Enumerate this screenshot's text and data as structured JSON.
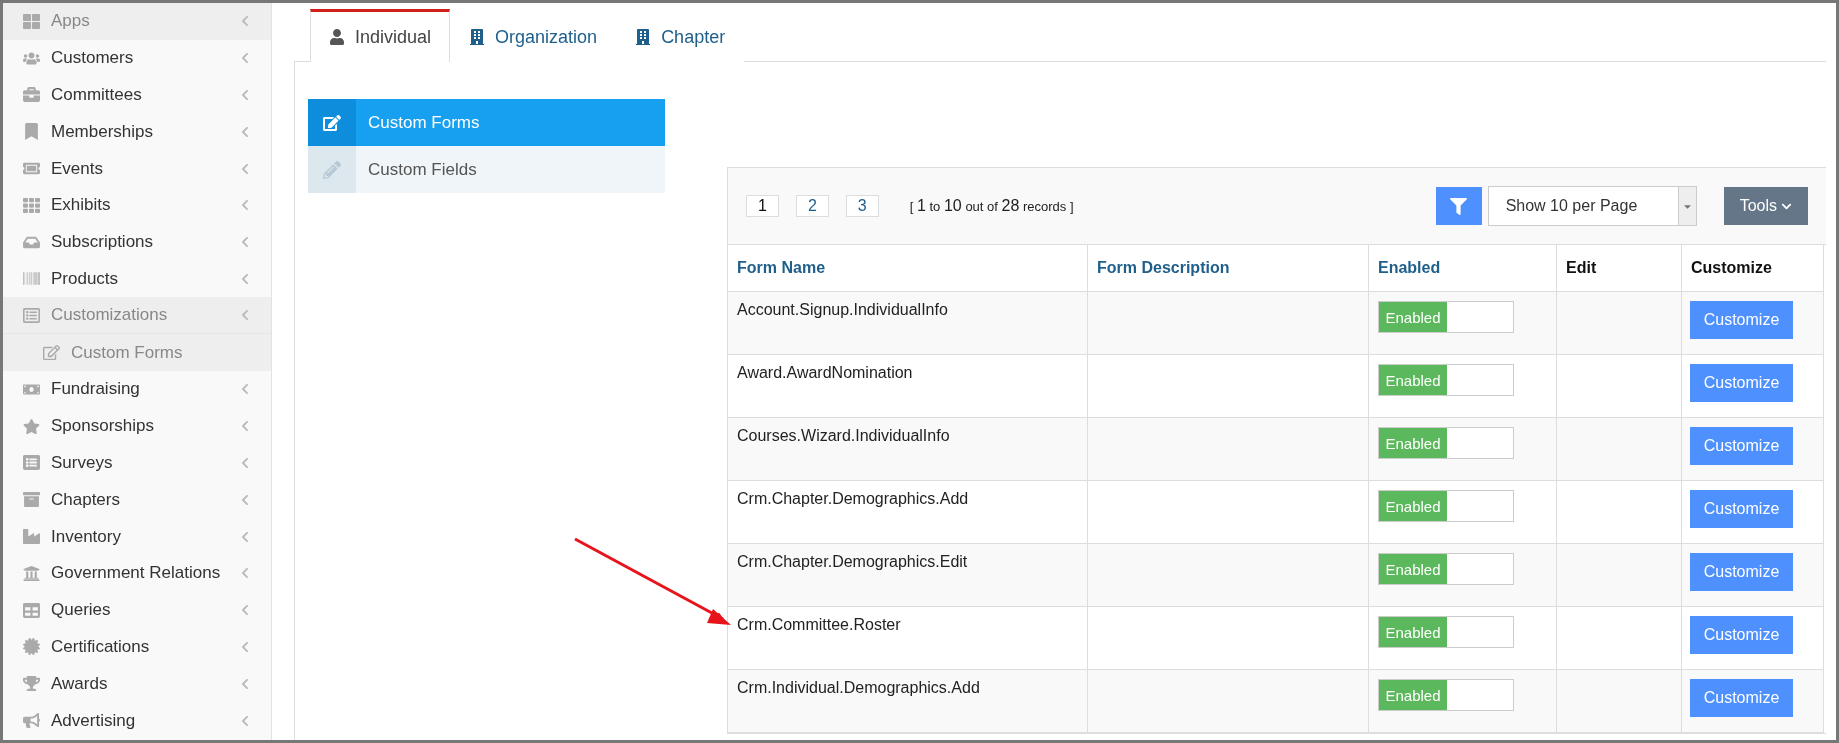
{
  "sidebar": {
    "items": [
      {
        "label": "Apps",
        "selected": true,
        "expanded": false
      },
      {
        "label": "Customers",
        "selected": false,
        "expanded": false
      },
      {
        "label": "Committees",
        "selected": false,
        "expanded": false
      },
      {
        "label": "Memberships",
        "selected": false,
        "expanded": false
      },
      {
        "label": "Events",
        "selected": false,
        "expanded": false
      },
      {
        "label": "Exhibits",
        "selected": false,
        "expanded": false
      },
      {
        "label": "Subscriptions",
        "selected": false,
        "expanded": false
      },
      {
        "label": "Products",
        "selected": false,
        "expanded": false
      },
      {
        "label": "Customizations",
        "selected": true,
        "expanded": true,
        "children": [
          {
            "label": "Custom Forms",
            "selected": true
          }
        ]
      },
      {
        "label": "Fundraising",
        "selected": false,
        "expanded": false
      },
      {
        "label": "Sponsorships",
        "selected": false,
        "expanded": false
      },
      {
        "label": "Surveys",
        "selected": false,
        "expanded": false
      },
      {
        "label": "Chapters",
        "selected": false,
        "expanded": false
      },
      {
        "label": "Inventory",
        "selected": false,
        "expanded": false
      },
      {
        "label": "Government Relations",
        "selected": false,
        "expanded": false
      },
      {
        "label": "Queries",
        "selected": false,
        "expanded": false
      },
      {
        "label": "Certifications",
        "selected": false,
        "expanded": false
      },
      {
        "label": "Awards",
        "selected": false,
        "expanded": false
      },
      {
        "label": "Advertising",
        "selected": false,
        "expanded": false
      }
    ]
  },
  "tabs": [
    {
      "label": "Individual",
      "selected": true
    },
    {
      "label": "Organization",
      "selected": false
    },
    {
      "label": "Chapter",
      "selected": false
    }
  ],
  "subnav": [
    {
      "label": "Custom Forms",
      "selected": true
    },
    {
      "label": "Custom Fields",
      "selected": false
    }
  ],
  "toolbar": {
    "pages": [
      {
        "label": "1",
        "selected": true
      },
      {
        "label": "2",
        "selected": false
      },
      {
        "label": "3",
        "selected": false
      }
    ],
    "records": [
      {
        "kind": "word",
        "text": "["
      },
      {
        "kind": "number",
        "text": "1"
      },
      {
        "kind": "word",
        "text": "to"
      },
      {
        "kind": "number",
        "text": "10"
      },
      {
        "kind": "word",
        "text": "out of"
      },
      {
        "kind": "number",
        "text": "28"
      },
      {
        "kind": "word",
        "text": "records"
      },
      {
        "kind": "word",
        "text": "]"
      }
    ],
    "per_page": "Show 10 per Page",
    "tools": "Tools"
  },
  "table": {
    "columns": [
      {
        "label": "Form Name",
        "sortable": true
      },
      {
        "label": "Form Description",
        "sortable": true
      },
      {
        "label": "Enabled",
        "sortable": true
      },
      {
        "label": "Edit",
        "sortable": false
      },
      {
        "label": "Customize",
        "sortable": false
      }
    ],
    "rows": [
      {
        "name": "Account.Signup.IndividualInfo",
        "toggle": "Enabled",
        "on": true,
        "action": "Customize"
      },
      {
        "name": "Award.AwardNomination",
        "toggle": "Enabled",
        "on": true,
        "action": "Customize"
      },
      {
        "name": "Courses.Wizard.IndividualInfo",
        "toggle": "Enabled",
        "on": true,
        "action": "Customize"
      },
      {
        "name": "Crm.Chapter.Demographics.Add",
        "toggle": "Enabled",
        "on": true,
        "action": "Customize"
      },
      {
        "name": "Crm.Chapter.Demographics.Edit",
        "toggle": "Enabled",
        "on": true,
        "action": "Customize"
      },
      {
        "name": "Crm.Committee.Roster",
        "toggle": "Enabled",
        "on": true,
        "action": "Customize"
      },
      {
        "name": "Crm.Individual.Demographics.Add",
        "toggle": "Enabled",
        "on": true,
        "action": "Customize"
      }
    ]
  }
}
